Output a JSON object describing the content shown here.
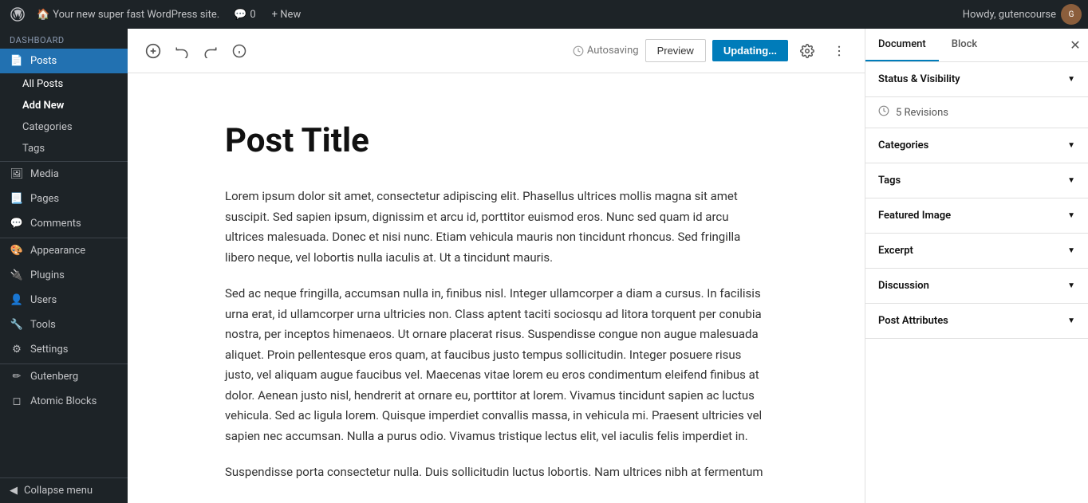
{
  "adminBar": {
    "wpLogo": "⚙",
    "siteName": "Your new super fast WordPress site.",
    "houseIcon": "🏠",
    "commentsCount": "0",
    "newLabel": "+ New",
    "howdy": "Howdy, gutencourse"
  },
  "sidebar": {
    "dashboardLabel": "Dashboard",
    "items": [
      {
        "id": "posts",
        "label": "Posts",
        "icon": "📄",
        "active": true
      },
      {
        "id": "all-posts",
        "label": "All Posts",
        "sub": true
      },
      {
        "id": "add-new",
        "label": "Add New",
        "sub": true,
        "activeSub": true
      },
      {
        "id": "categories",
        "label": "Categories",
        "sub": true
      },
      {
        "id": "tags",
        "label": "Tags",
        "sub": true
      },
      {
        "id": "media",
        "label": "Media",
        "icon": "🖼"
      },
      {
        "id": "pages",
        "label": "Pages",
        "icon": "📃"
      },
      {
        "id": "comments",
        "label": "Comments",
        "icon": "💬"
      },
      {
        "id": "appearance",
        "label": "Appearance",
        "icon": "🎨"
      },
      {
        "id": "plugins",
        "label": "Plugins",
        "icon": "🔌"
      },
      {
        "id": "users",
        "label": "Users",
        "icon": "👤"
      },
      {
        "id": "tools",
        "label": "Tools",
        "icon": "🔧"
      },
      {
        "id": "settings",
        "label": "Settings",
        "icon": "⚙"
      },
      {
        "id": "gutenberg",
        "label": "Gutenberg",
        "icon": "✏"
      },
      {
        "id": "atomic-blocks",
        "label": "Atomic Blocks",
        "icon": "◻"
      }
    ],
    "collapseLabel": "Collapse menu"
  },
  "toolbar": {
    "addIcon": "+",
    "undoIcon": "↩",
    "redoIcon": "↪",
    "infoIcon": "ℹ",
    "autosaveText": "Autosaving",
    "previewLabel": "Preview",
    "updateLabel": "Updating...",
    "settingsIcon": "⚙",
    "moreIcon": "⋮"
  },
  "editor": {
    "postTitle": "Post Title",
    "paragraph1": "Lorem ipsum dolor sit amet, consectetur adipiscing elit. Phasellus ultrices mollis magna sit amet suscipit. Sed sapien ipsum, dignissim et arcu id, porttitor euismod eros. Nunc sed quam id arcu ultrices malesuada. Donec et nisi nunc. Etiam vehicula mauris non tincidunt rhoncus. Sed fringilla libero neque, vel lobortis nulla iaculis at. Ut a tincidunt mauris.",
    "paragraph2": "Sed ac neque fringilla, accumsan nulla in, finibus nisl. Integer ullamcorper a diam a cursus. In facilisis urna erat, id ullamcorper urna ultricies non. Class aptent taciti sociosqu ad litora torquent per conubia nostra, per inceptos himenaeos. Ut ornare placerat risus. Suspendisse congue non augue malesuada aliquet. Proin pellentesque eros quam, at faucibus justo tempus sollicitudin. Integer posuere risus justo, vel aliquam augue faucibus vel. Maecenas vitae lorem eu eros condimentum eleifend finibus at dolor. Aenean justo nisl, hendrerit at ornare eu, porttitor at lorem. Vivamus tincidunt sapien ac luctus vehicula. Sed ac ligula lorem. Quisque imperdiet convallis massa, in vehicula mi. Praesent ultricies vel sapien nec accumsan. Nulla a purus odio. Vivamus tristique lectus elit, vel iaculis felis imperdiet in.",
    "paragraph3": "Suspendisse porta consectetur nulla. Duis sollicitudin luctus lobortis. Nam ultrices nibh at fermentum"
  },
  "rightPanel": {
    "documentTab": "Document",
    "blockTab": "Block",
    "sections": [
      {
        "id": "status-visibility",
        "label": "Status & Visibility",
        "hasArrow": true
      },
      {
        "id": "revisions",
        "label": "5 Revisions",
        "icon": "clock"
      },
      {
        "id": "categories",
        "label": "Categories",
        "hasArrow": true
      },
      {
        "id": "tags",
        "label": "Tags",
        "hasArrow": true
      },
      {
        "id": "featured-image",
        "label": "Featured Image",
        "hasArrow": true
      },
      {
        "id": "excerpt",
        "label": "Excerpt",
        "hasArrow": true
      },
      {
        "id": "discussion",
        "label": "Discussion",
        "hasArrow": true
      },
      {
        "id": "post-attributes",
        "label": "Post Attributes",
        "hasArrow": true
      }
    ]
  }
}
